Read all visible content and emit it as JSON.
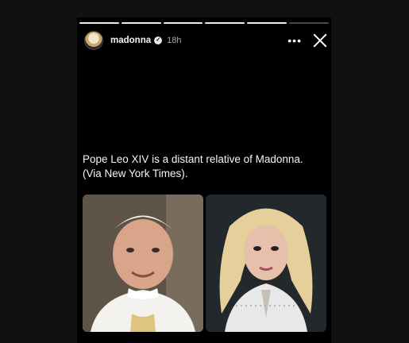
{
  "story": {
    "progress_segments": [
      true,
      true,
      true,
      true,
      true,
      false
    ],
    "username": "madonna",
    "time": "18h",
    "more_icon": "more-horizontal-icon",
    "close_icon": "close-icon",
    "caption": "Pope Leo XIV is a distant relative of Madonna. (Via New York Times).",
    "images": [
      {
        "name": "pope-photo"
      },
      {
        "name": "madonna-photo"
      }
    ]
  }
}
